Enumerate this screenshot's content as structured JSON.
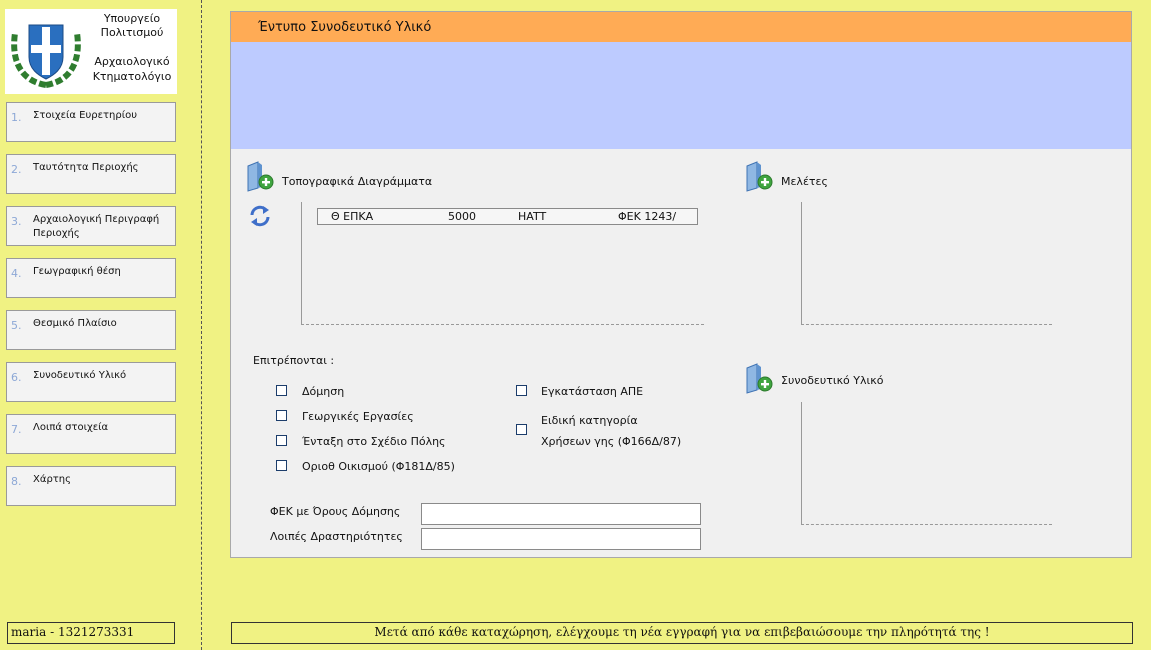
{
  "logo": {
    "lines": [
      "Υπουργείο",
      "Πολιτισμού",
      "Αρχαιολογικό",
      "Κτηματολόγιο"
    ]
  },
  "nav": {
    "items": [
      {
        "num": "1.",
        "label": "Στοιχεία Ευρετηρίου"
      },
      {
        "num": "2.",
        "label": "Ταυτότητα Περιοχής"
      },
      {
        "num": "3.",
        "label": "Αρχαιολογική Περιγραφή Περιοχής"
      },
      {
        "num": "4.",
        "label": "Γεωγραφική θέση"
      },
      {
        "num": "5.",
        "label": "Θεσμικό Πλαίσιο"
      },
      {
        "num": "6.",
        "label": "Συνοδευτικό Υλικό"
      },
      {
        "num": "7.",
        "label": "Λοιπά στοιχεία"
      },
      {
        "num": "8.",
        "label": "Χάρτης"
      }
    ]
  },
  "footer": {
    "user": "maria - 1321273331",
    "message": "Μετά από κάθε καταχώρηση, ελέγχουμε τη νέα εγγραφή για να επιβεβαιώσουμε την πληρότητά της !"
  },
  "form": {
    "title": "Έντυπο Συνοδευτικό Υλικό",
    "sections": {
      "topographic": "Τοπογραφικά Διαγράμματα",
      "studies": "Μελέτες",
      "materials": "Συνοδευτικό Υλικό"
    },
    "topo_rows": [
      {
        "col1": "Θ ΕΠΚΑ",
        "col2": "5000",
        "col3": "HATT",
        "col4": "ΦΕΚ 1243/"
      }
    ],
    "allowed_label": "Επιτρέπονται :",
    "checkboxes": {
      "domisi": "Δόμηση",
      "georgikes": "Γεωργικές Εργασίες",
      "entaxi": "Ένταξη στο Σχέδιο Πόλης",
      "orioth": "Οριοθ Οικισμού (Φ181Δ/85)",
      "ape": "Εγκατάσταση ΑΠΕ",
      "eidiki_1": "Ειδική κατηγορία",
      "eidiki_2": "Χρήσεων γης (Φ166Δ/87)"
    },
    "fields": {
      "fek_label": "ΦΕΚ με Όρους Δόμησης",
      "fek_value": "",
      "other_label": "Λοιπές Δραστηριότητες",
      "other_value": ""
    }
  },
  "colors": {
    "background": "#f0f283",
    "header": "#ffab55",
    "band": "#bdcbff",
    "panel": "#f0f0f0"
  },
  "icons": {
    "logo": "greek-emblem-icon",
    "add_folder": "folder-add-icon",
    "refresh": "refresh-icon"
  }
}
